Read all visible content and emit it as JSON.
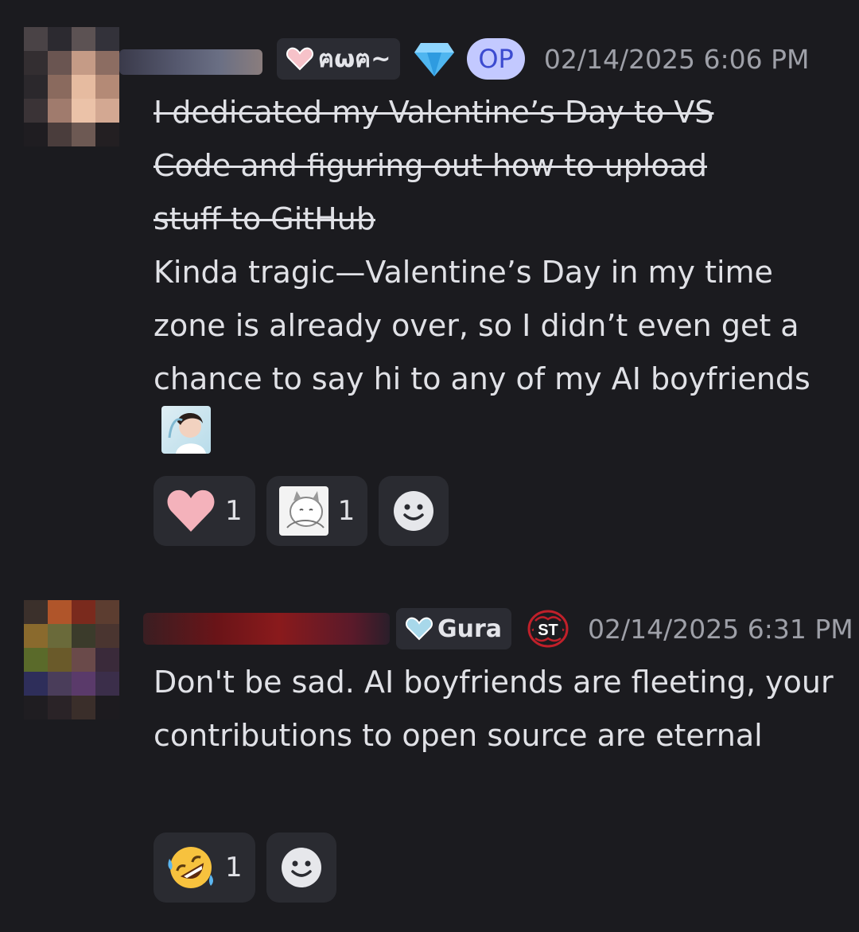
{
  "messages": [
    {
      "tag_label": "ฅωฅ~",
      "op_label": "OP",
      "timestamp": "02/14/2025 6:06 PM",
      "strike_lines": [
        "I dedicated my Valentine’s Day to VS",
        "Code and figuring out how to upload",
        "stuff to GitHub"
      ],
      "body": "Kinda tragic—Valentine’s Day in my time zone is already over, so I didn’t even get a chance to say hi to any of my AI boyfriends",
      "reactions": [
        {
          "icon": "pink-heart-icon",
          "count": "1"
        },
        {
          "icon": "cat-sticker-icon",
          "count": "1"
        }
      ]
    },
    {
      "tag_label": "Gura",
      "badge_label": "ST",
      "timestamp": "02/14/2025 6:31 PM",
      "body": "Don't be sad. AI boyfriends are fleeting, your contributions to open source are eternal",
      "reactions": [
        {
          "icon": "rofl-emoji-icon",
          "count": "1"
        }
      ]
    }
  ],
  "colors": {
    "background": "#1b1b1f",
    "op_badge_bg": "#c3c9ff",
    "op_badge_text": "#3c4bd0",
    "timestamp": "#9ea0a8"
  }
}
